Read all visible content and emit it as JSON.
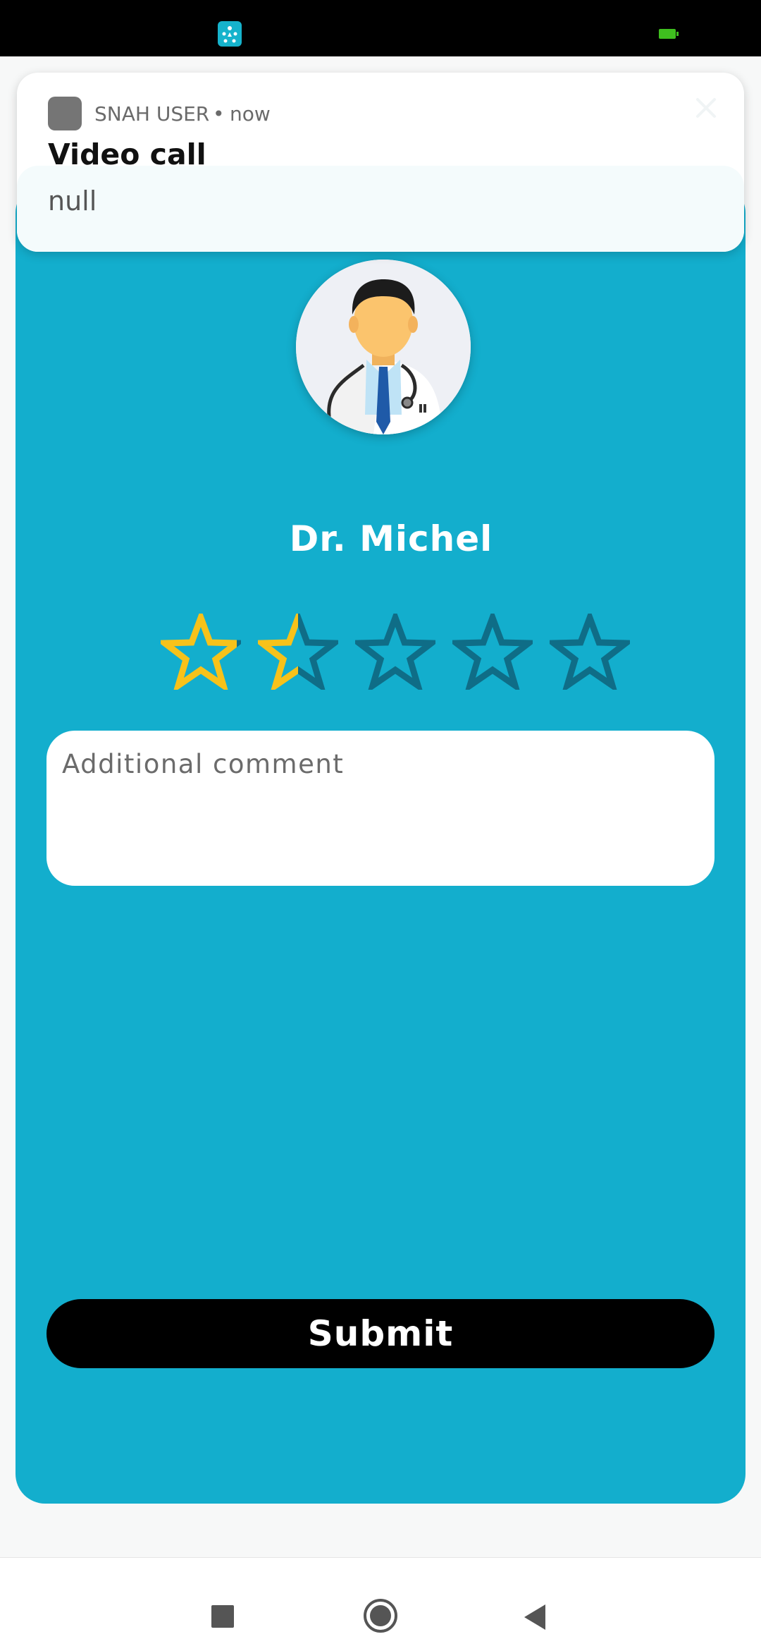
{
  "status_bar": {
    "app_icon": "snah-app-icon",
    "battery_icon": "battery-icon"
  },
  "notification": {
    "app_name": "SNAH USER",
    "separator": "•",
    "time": "now",
    "title": "Video call",
    "body": "null",
    "close_icon": "close-icon"
  },
  "rating": {
    "doctor_name": "Dr. Michel",
    "avatar_icon": "doctor-avatar",
    "stars_max": 5,
    "stars_value": 1.5,
    "colors": {
      "star_filled": "#f7c21a",
      "star_empty": "#0f6d87",
      "card": "#13aecd"
    },
    "comment_placeholder": "Additional comment",
    "comment_value": "",
    "submit_label": "Submit"
  },
  "nav_bar": {
    "recents_icon": "recents-icon",
    "home_icon": "home-icon",
    "back_icon": "back-icon"
  }
}
